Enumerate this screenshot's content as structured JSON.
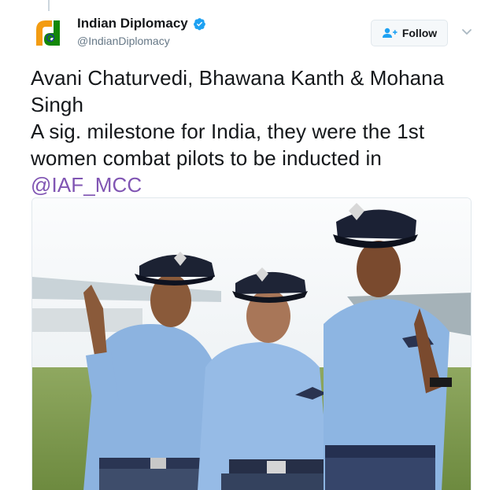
{
  "author": {
    "display_name": "Indian Diplomacy",
    "handle": "@IndianDiplomacy",
    "verified": true,
    "avatar_icon": "indian-diplomacy-logo"
  },
  "actions": {
    "follow_label": "Follow",
    "follow_icon": "add-user-icon",
    "menu_icon": "chevron-down-icon"
  },
  "tweet": {
    "line1": "Avani Chaturvedi, Bhawana Kanth & Mohana",
    "line2": "Singh",
    "line3": "A sig. milestone for India, they were the 1st",
    "line4": "women combat pilots to be inducted in",
    "mention": "@IAF_MCC"
  },
  "media": {
    "type": "photo",
    "subject": "three women pilots in uniform"
  },
  "colors": {
    "mention": "#8055b3",
    "verified": "#1da1f2",
    "text": "#14171a",
    "muted": "#657786"
  }
}
